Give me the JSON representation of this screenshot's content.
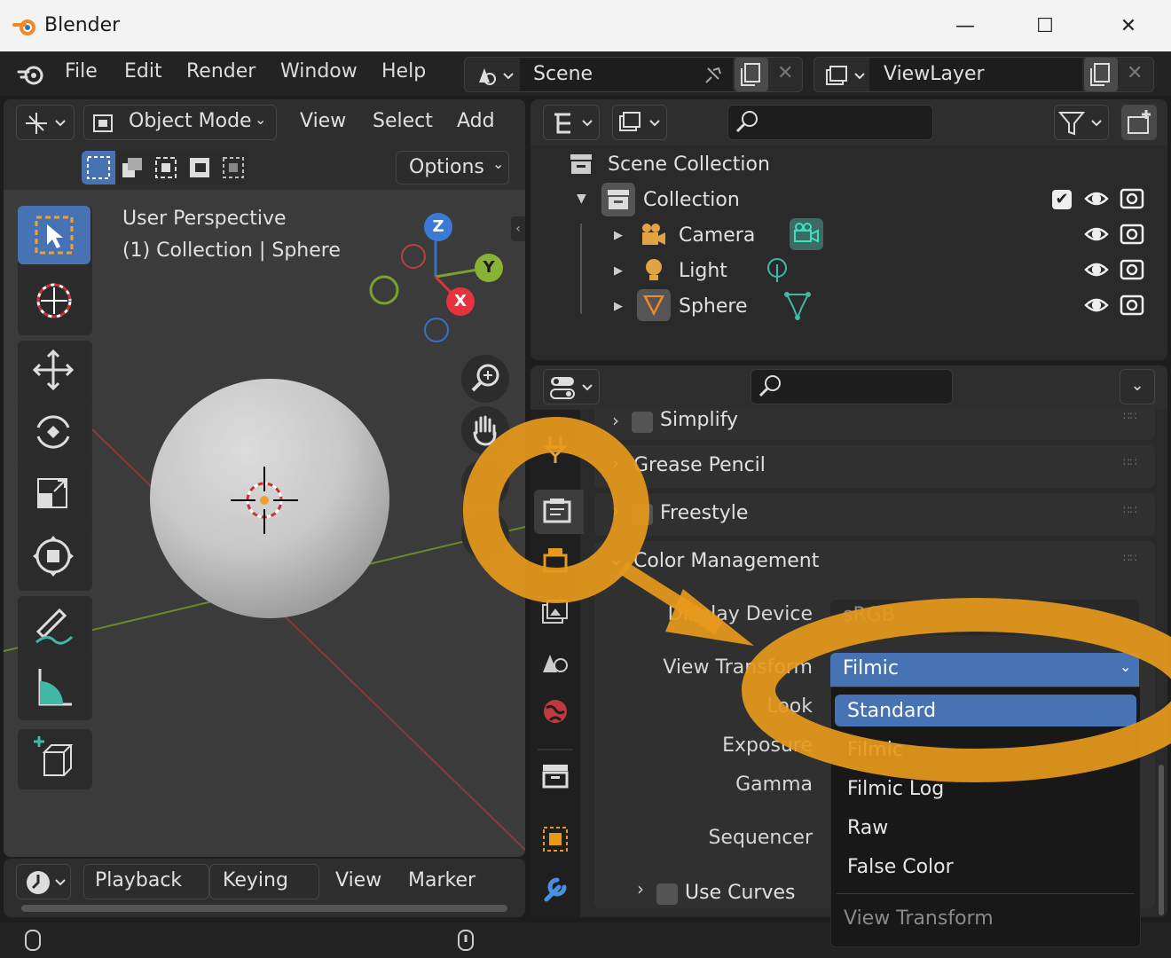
{
  "window": {
    "title": "Blender",
    "minimize": "—",
    "maximize": "☐",
    "close": "✕"
  },
  "menubar": {
    "items": [
      "File",
      "Edit",
      "Render",
      "Window",
      "Help"
    ],
    "scene": "Scene",
    "viewlayer": "ViewLayer"
  },
  "viewport": {
    "mode": "Object Mode",
    "menus": [
      "View",
      "Select",
      "Add"
    ],
    "options": "Options",
    "overlay_line1": "User Perspective",
    "overlay_line2": "(1) Collection | Sphere",
    "gizmo": {
      "z": "Z",
      "y": "Y",
      "x": "X"
    }
  },
  "timeline": {
    "items": [
      "Playback",
      "Keying",
      "View",
      "Marker"
    ]
  },
  "outliner": {
    "scene_collection": "Scene Collection",
    "collection": "Collection",
    "items": [
      "Camera",
      "Light",
      "Sphere"
    ]
  },
  "properties": {
    "panels": [
      "Simplify",
      "Grease Pencil",
      "Freestyle",
      "Color Management"
    ],
    "labels": {
      "display_device": "Display Device",
      "view_transform": "View Transform",
      "look": "Look",
      "exposure": "Exposure",
      "gamma": "Gamma",
      "sequencer": "Sequencer",
      "use_curves": "Use Curves"
    },
    "display_device_value": "sRGB",
    "view_transform_value": "Filmic"
  },
  "dropdown": {
    "options": [
      "Standard",
      "Filmic",
      "Filmic Log",
      "Raw",
      "False Color"
    ],
    "highlighted": "Standard",
    "footer": "View Transform"
  },
  "colors": {
    "accent": "#4772b3",
    "annotation": "#e79a1c",
    "object": "#3fb8a6"
  }
}
